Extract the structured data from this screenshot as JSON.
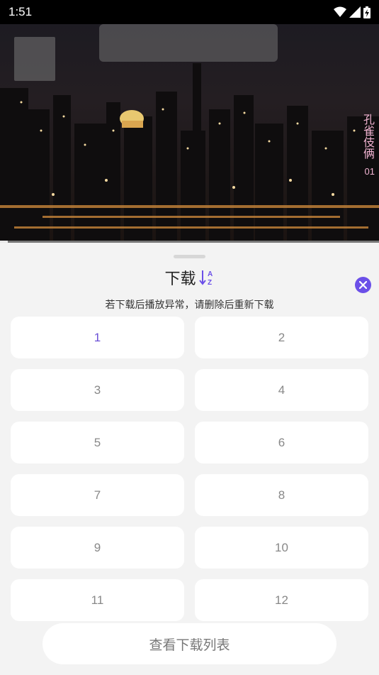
{
  "status_bar": {
    "time": "1:51",
    "icons": [
      "wifi-icon",
      "signal-icon",
      "battery-charging-icon"
    ]
  },
  "video": {
    "overlay_title": "孔雀伎俩",
    "overlay_episode": "01",
    "progress": 0.02
  },
  "sheet": {
    "title": "下载",
    "sort_icon": "sort-az-icon",
    "close_icon": "close-icon",
    "hint": "若下载后播放异常，请删除后重新下载",
    "episodes": [
      {
        "label": "1",
        "active": true
      },
      {
        "label": "2",
        "active": false
      },
      {
        "label": "3",
        "active": false
      },
      {
        "label": "4",
        "active": false
      },
      {
        "label": "5",
        "active": false
      },
      {
        "label": "6",
        "active": false
      },
      {
        "label": "7",
        "active": false
      },
      {
        "label": "8",
        "active": false
      },
      {
        "label": "9",
        "active": false
      },
      {
        "label": "10",
        "active": false
      },
      {
        "label": "11",
        "active": false
      },
      {
        "label": "12",
        "active": false
      }
    ],
    "view_list_button": "查看下载列表"
  },
  "colors": {
    "accent": "#6b4fe8",
    "active_episode_text": "#6a4fd6",
    "overlay_text": "#f2b4d2"
  }
}
